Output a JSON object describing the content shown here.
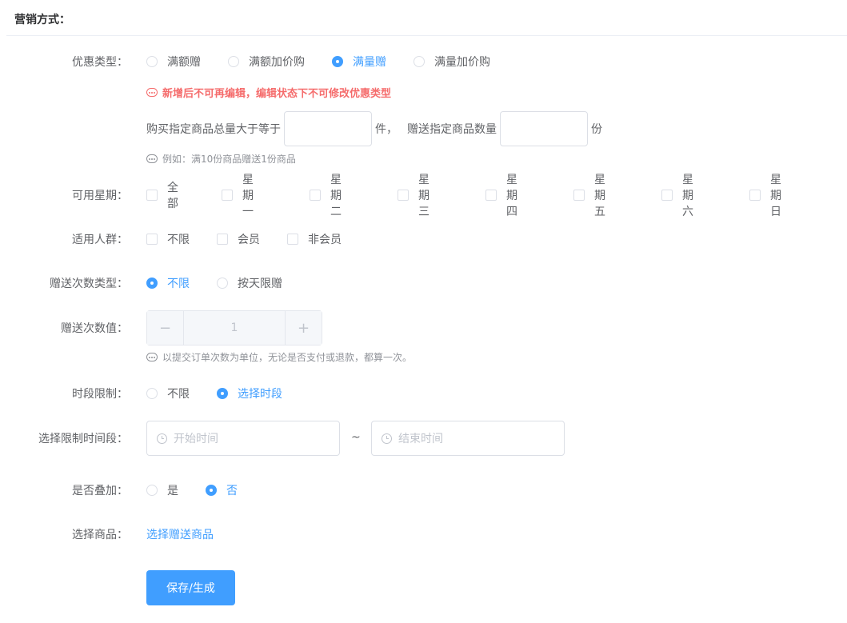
{
  "section": {
    "title": "营销方式："
  },
  "promo_type": {
    "label": "优惠类型：",
    "options": [
      {
        "label": "满额赠",
        "checked": false
      },
      {
        "label": "满额加价购",
        "checked": false
      },
      {
        "label": "满量赠",
        "checked": true
      },
      {
        "label": "满量加价购",
        "checked": false
      }
    ],
    "warning": "新增后不可再编辑，编辑状态下不可修改优惠类型"
  },
  "quantity_rule": {
    "prefix": "购买指定商品总量大于等于",
    "unit1": "件，",
    "middle": "赠送指定商品数量",
    "unit2": "份",
    "min_qty_value": "",
    "gift_qty_value": "",
    "hint": "例如：满10份商品赠送1份商品"
  },
  "weekdays": {
    "label": "可用星期：",
    "options": [
      "全部",
      "星期一",
      "星期二",
      "星期三",
      "星期四",
      "星期五",
      "星期六",
      "星期日"
    ]
  },
  "audience": {
    "label": "适用人群：",
    "options": [
      "不限",
      "会员",
      "非会员"
    ]
  },
  "gift_count_type": {
    "label": "赠送次数类型：",
    "options": [
      {
        "label": "不限",
        "checked": true
      },
      {
        "label": "按天限赠",
        "checked": false
      }
    ]
  },
  "gift_count_value": {
    "label": "赠送次数值：",
    "value": "1",
    "minus": "−",
    "plus": "+",
    "hint": "以提交订单次数为单位，无论是否支付或退款，都算一次。"
  },
  "time_limit": {
    "label": "时段限制：",
    "options": [
      {
        "label": "不限",
        "checked": false
      },
      {
        "label": "选择时段",
        "checked": true
      }
    ]
  },
  "time_range": {
    "label": "选择限制时间段：",
    "start_placeholder": "开始时间",
    "separator": "~",
    "end_placeholder": "结束时间"
  },
  "stackable": {
    "label": "是否叠加：",
    "options": [
      {
        "label": "是",
        "checked": false
      },
      {
        "label": "否",
        "checked": true
      }
    ]
  },
  "products": {
    "label": "选择商品：",
    "link": "选择赠送商品"
  },
  "submit": {
    "label": "保存/生成"
  },
  "colors": {
    "primary": "#409eff",
    "danger": "#f56c6c",
    "hint": "#909399",
    "border": "#dcdfe6"
  }
}
